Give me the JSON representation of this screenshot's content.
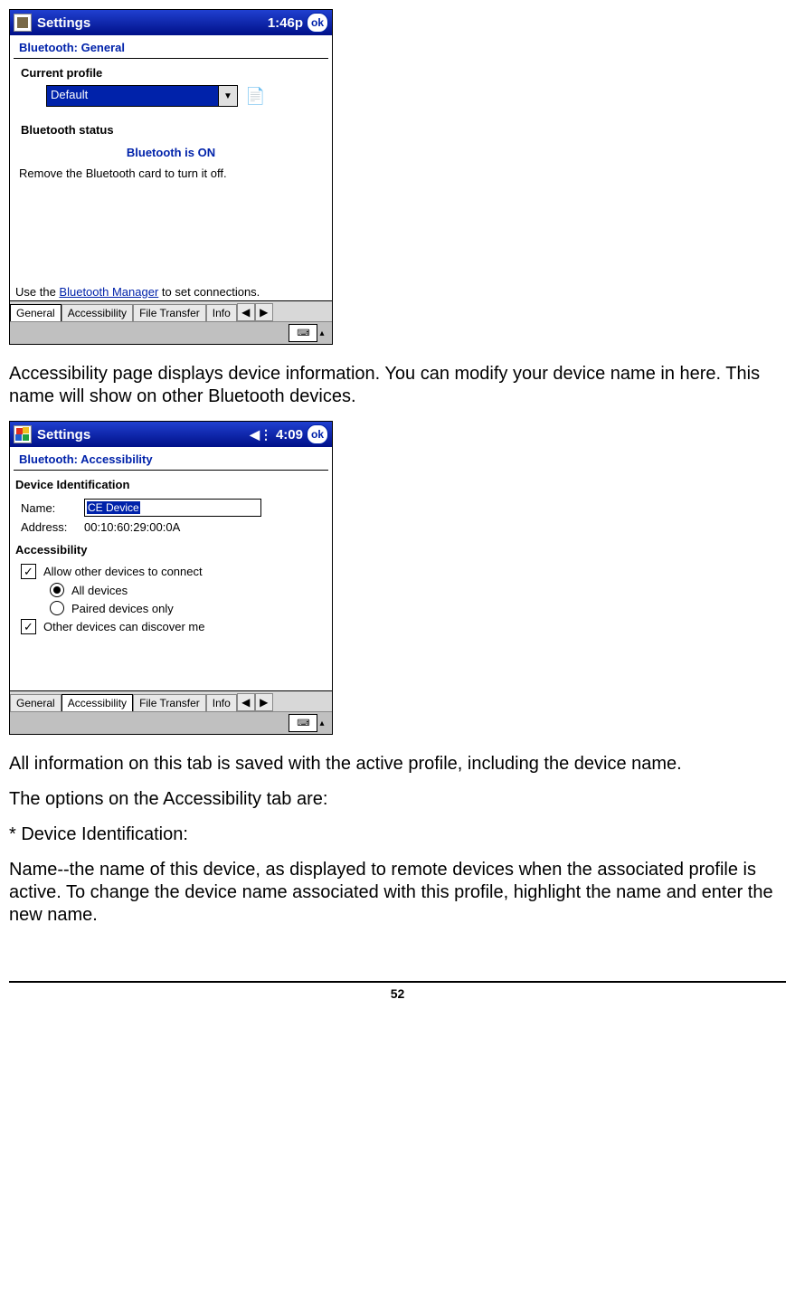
{
  "page_number": "52",
  "para1": "Accessibility page displays device information. You can modify your device name in here. This name will show on other Bluetooth devices.",
  "para2": "All information on this tab is saved with the active profile, including the device name.",
  "para3": "The options on the Accessibility tab are:",
  "para4": "* Device Identification:",
  "para5": "Name--the name of this device, as displayed to remote devices when the associated profile is active. To change the device name associated with this profile, highlight the name and enter the new name.",
  "shot1": {
    "title": "Settings",
    "time": "1:46p",
    "ok": "ok",
    "header": "Bluetooth: General",
    "group_profile": "Current profile",
    "combo_value": "Default",
    "group_status": "Bluetooth status",
    "status_text": "Bluetooth is ON",
    "helper": "Remove the Bluetooth card to turn it off.",
    "use_prefix": "Use the ",
    "use_link": "Bluetooth Manager",
    "use_suffix": " to set connections.",
    "tabs": {
      "t1": "General",
      "t2": "Accessibility",
      "t3": "File Transfer",
      "t4": "Info"
    }
  },
  "shot2": {
    "title": "Settings",
    "time": "4:09",
    "ok": "ok",
    "header": "Bluetooth: Accessibility",
    "group_id": "Device Identification",
    "name_label": "Name:",
    "name_value": "CE Device",
    "addr_label": "Address:",
    "addr_value": "00:10:60:29:00:0A",
    "group_acc": "Accessibility",
    "cb1": "Allow other devices to connect",
    "r1": "All devices",
    "r2": "Paired devices only",
    "cb2": "Other devices can discover me",
    "tabs": {
      "t1": "General",
      "t2": "Accessibility",
      "t3": "File Transfer",
      "t4": "Info"
    }
  }
}
